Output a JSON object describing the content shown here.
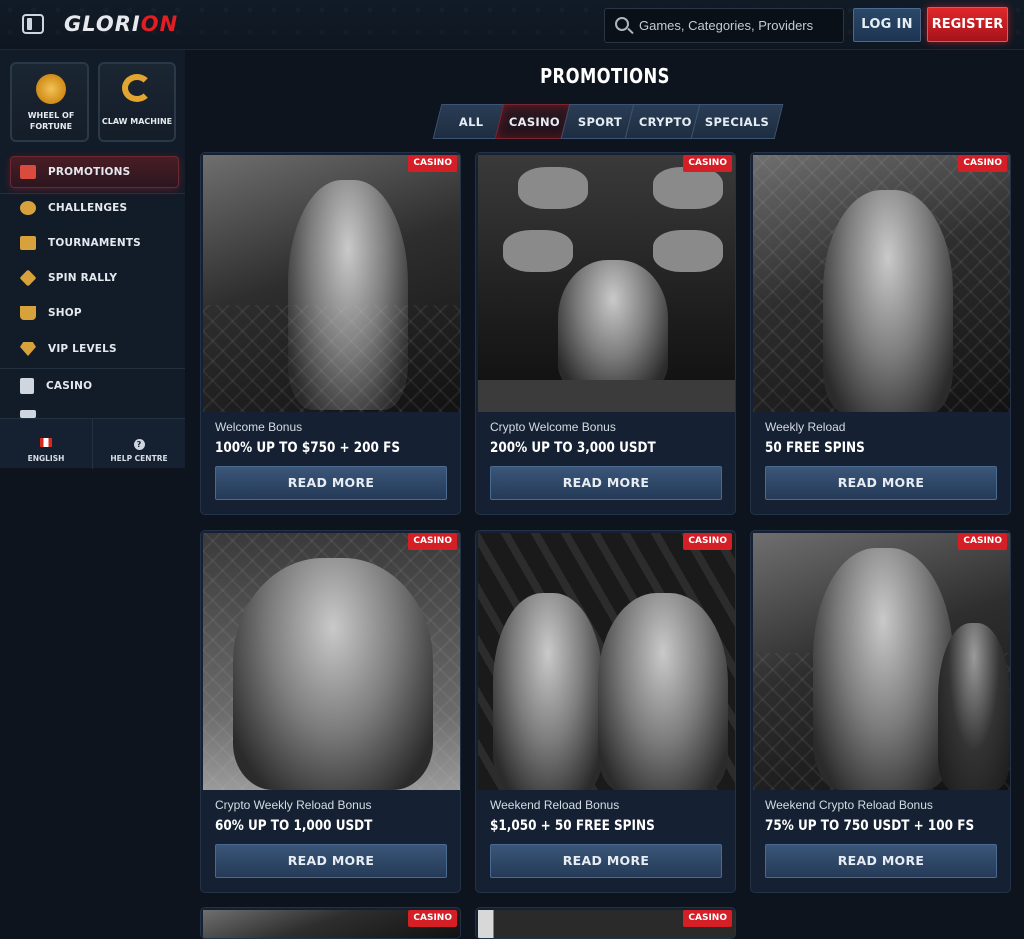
{
  "header": {
    "logo_left": "GLORI",
    "logo_right": "ON",
    "search_placeholder": "Games, Categories, Providers",
    "login_label": "LOG IN",
    "register_label": "REGISTER"
  },
  "sidebar": {
    "tiles": [
      {
        "label": "WHEEL OF FORTUNE",
        "icon": "wheel-icon"
      },
      {
        "label": "CLAW MACHINE",
        "icon": "claw-icon"
      }
    ],
    "items": [
      {
        "label": "PROMOTIONS",
        "icon": "gift-icon",
        "active": true
      },
      {
        "label": "CHALLENGES",
        "icon": "medal-icon"
      },
      {
        "label": "TOURNAMENTS",
        "icon": "podium-icon"
      },
      {
        "label": "SPIN RALLY",
        "icon": "flag-icon"
      },
      {
        "label": "SHOP",
        "icon": "basket-icon"
      },
      {
        "label": "VIP LEVELS",
        "icon": "diamond-icon"
      },
      {
        "label": "CASINO",
        "icon": "slot-machine-icon"
      }
    ],
    "footer": {
      "language": "ENGLISH",
      "help": "HELP CENTRE"
    }
  },
  "main": {
    "title": "PROMOTIONS",
    "tabs": [
      {
        "label": "ALL"
      },
      {
        "label": "CASINO",
        "active": true
      },
      {
        "label": "SPORT"
      },
      {
        "label": "CRYPTO"
      },
      {
        "label": "SPECIALS"
      }
    ],
    "cards": [
      {
        "badge": "CASINO",
        "subtitle": "Welcome Bonus",
        "headline": "100% UP TO $750 + 200 FS",
        "button": "READ MORE"
      },
      {
        "badge": "CASINO",
        "subtitle": "Crypto Welcome Bonus",
        "headline": "200% UP TO 3,000 USDT",
        "button": "READ MORE"
      },
      {
        "badge": "CASINO",
        "subtitle": "Weekly Reload",
        "headline": "50 FREE SPINS",
        "button": "READ MORE"
      },
      {
        "badge": "CASINO",
        "subtitle": "Crypto Weekly Reload Bonus",
        "headline": "60% UP TO 1,000 USDT",
        "button": "READ MORE"
      },
      {
        "badge": "CASINO",
        "subtitle": "Weekend Reload Bonus",
        "headline": "$1,050 + 50 FREE SPINS",
        "button": "READ MORE"
      },
      {
        "badge": "CASINO",
        "subtitle": "Weekend Crypto Reload Bonus",
        "headline": "75% UP TO 750 USDT + 100 FS",
        "button": "READ MORE"
      },
      {
        "badge": "CASINO"
      },
      {
        "badge": "CASINO"
      }
    ]
  },
  "colors": {
    "accent_red": "#d41f26",
    "button_blue": "#2b4868",
    "background": "#0d141d"
  }
}
